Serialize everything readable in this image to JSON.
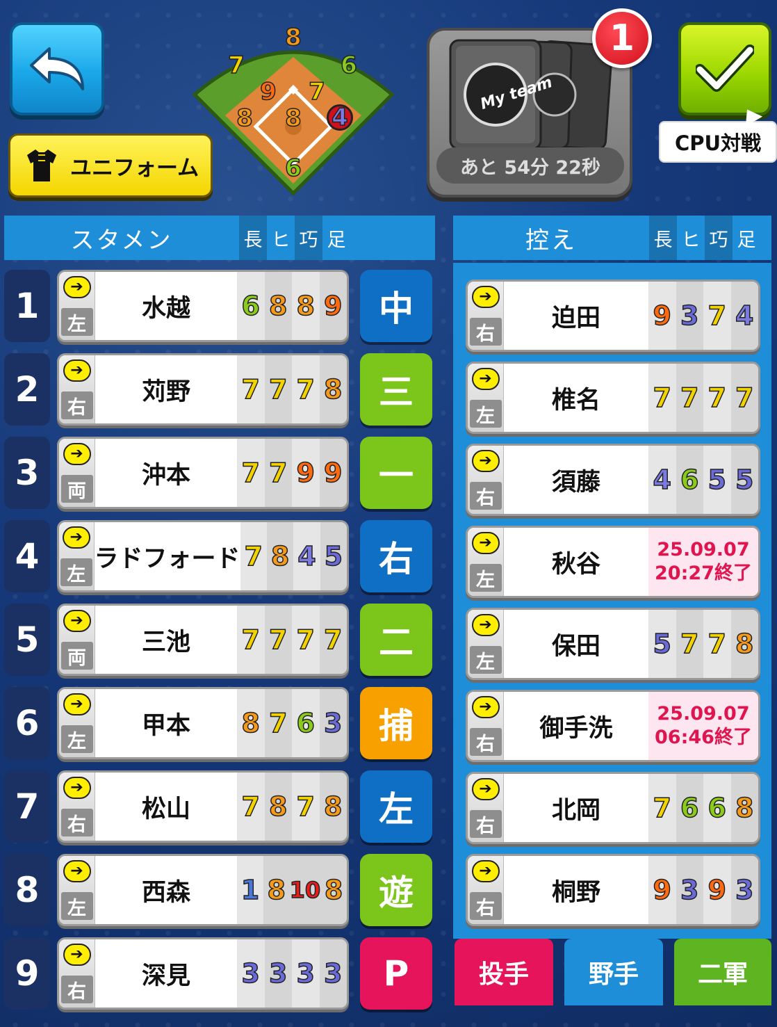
{
  "header": {
    "back_icon": "back-arrow-icon",
    "uniform_label": "ユニフォーム",
    "uniform_icon": "jersey-icon",
    "card_time": "あと 54分 22秒",
    "card_logo_text": "My team",
    "badge_count": "1",
    "confirm_icon": "checkmark-icon",
    "cpu_label": "CPU対戦"
  },
  "field": {
    "positions": [
      {
        "pos": "cf",
        "value": "8"
      },
      {
        "pos": "lf",
        "value": "7"
      },
      {
        "pos": "rf",
        "value": "6"
      },
      {
        "pos": "ss",
        "value": "9"
      },
      {
        "pos": "2b",
        "value": "7"
      },
      {
        "pos": "3b",
        "value": "8"
      },
      {
        "pos": "p",
        "value": "8"
      },
      {
        "pos": "1b",
        "value": "4"
      },
      {
        "pos": "c",
        "value": "6"
      }
    ]
  },
  "lineup": {
    "title": "スタメン",
    "stat_headers": [
      "長",
      "ヒ",
      "巧",
      "足"
    ],
    "players": [
      {
        "order": "1",
        "hand": "左",
        "name": "水越",
        "stats": [
          "6",
          "8",
          "8",
          "9"
        ],
        "position": "中",
        "pos_color": "#0e6fc4"
      },
      {
        "order": "2",
        "hand": "右",
        "name": "苅野",
        "stats": [
          "7",
          "7",
          "7",
          "8"
        ],
        "position": "三",
        "pos_color": "#7cc61b"
      },
      {
        "order": "3",
        "hand": "両",
        "name": "沖本",
        "stats": [
          "7",
          "7",
          "9",
          "9"
        ],
        "position": "一",
        "pos_color": "#7cc61b"
      },
      {
        "order": "4",
        "hand": "左",
        "name": "ラドフォード",
        "stats": [
          "7",
          "8",
          "4",
          "5"
        ],
        "position": "右",
        "pos_color": "#0e6fc4"
      },
      {
        "order": "5",
        "hand": "両",
        "name": "三池",
        "stats": [
          "7",
          "7",
          "7",
          "7"
        ],
        "position": "二",
        "pos_color": "#7cc61b"
      },
      {
        "order": "6",
        "hand": "左",
        "name": "甲本",
        "stats": [
          "8",
          "7",
          "6",
          "3"
        ],
        "position": "捕",
        "pos_color": "#f7a000"
      },
      {
        "order": "7",
        "hand": "右",
        "name": "松山",
        "stats": [
          "7",
          "8",
          "7",
          "8"
        ],
        "position": "左",
        "pos_color": "#0e6fc4"
      },
      {
        "order": "8",
        "hand": "左",
        "name": "西森",
        "stats": [
          "1",
          "8",
          "10",
          "8"
        ],
        "position": "遊",
        "pos_color": "#7cc61b"
      },
      {
        "order": "9",
        "hand": "右",
        "name": "深見",
        "stats": [
          "3",
          "3",
          "3",
          "3"
        ],
        "position": "P",
        "pos_color": "#e6145a"
      }
    ]
  },
  "bench": {
    "title": "控え",
    "stat_headers": [
      "長",
      "ヒ",
      "巧",
      "足"
    ],
    "players": [
      {
        "hand": "右",
        "name": "迫田",
        "stats": [
          "9",
          "3",
          "7",
          "4"
        ],
        "ended": null
      },
      {
        "hand": "左",
        "name": "椎名",
        "stats": [
          "7",
          "7",
          "7",
          "7"
        ],
        "ended": null
      },
      {
        "hand": "右",
        "name": "須藤",
        "stats": [
          "4",
          "6",
          "5",
          "5"
        ],
        "ended": null
      },
      {
        "hand": "左",
        "name": "秋谷",
        "stats": null,
        "ended": [
          "25.09.07",
          "20:27終了"
        ]
      },
      {
        "hand": "左",
        "name": "保田",
        "stats": [
          "5",
          "7",
          "7",
          "8"
        ],
        "ended": null
      },
      {
        "hand": "右",
        "name": "御手洗",
        "stats": null,
        "ended": [
          "25.09.07",
          "06:46終了"
        ]
      },
      {
        "hand": "右",
        "name": "北岡",
        "stats": [
          "7",
          "6",
          "6",
          "8"
        ],
        "ended": null
      },
      {
        "hand": "右",
        "name": "桐野",
        "stats": [
          "9",
          "3",
          "9",
          "3"
        ],
        "ended": null
      }
    ]
  },
  "tabs": [
    {
      "label": "投手",
      "color": "#e6145a"
    },
    {
      "label": "野手",
      "color": "#1e8ed8"
    },
    {
      "label": "二軍",
      "color": "#5fb521"
    }
  ],
  "stat_colors": {
    "1": "#4a78d8",
    "3": "#6a6ad8",
    "4": "#7a7ae0",
    "5": "#6a6ad8",
    "6": "#8acb1c",
    "7": "#f2d200",
    "8": "#f59a1a",
    "9": "#ff6a10",
    "10": "#e61e1e"
  }
}
